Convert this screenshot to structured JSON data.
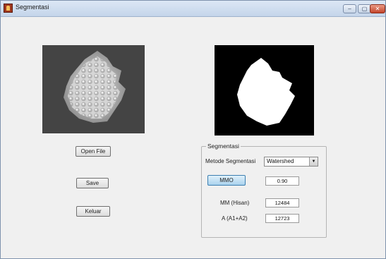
{
  "window": {
    "title": "Segmentasi",
    "controls": {
      "minimize": "–",
      "maximize": "▢",
      "close": "✕"
    }
  },
  "buttons": {
    "open_file": "Open File",
    "save": "Save",
    "exit": "Keluar"
  },
  "segmentasi": {
    "group_title": "Segmentasi",
    "method_label": "Metode Segmentasi",
    "method_selected": "Watershed",
    "mmo_button": "MMO",
    "mmo_value": "0.90",
    "mm_label": "MM (Hisan)",
    "mm_value": "12484",
    "area_label": "A (A1+A2)",
    "area_value": "12723"
  }
}
